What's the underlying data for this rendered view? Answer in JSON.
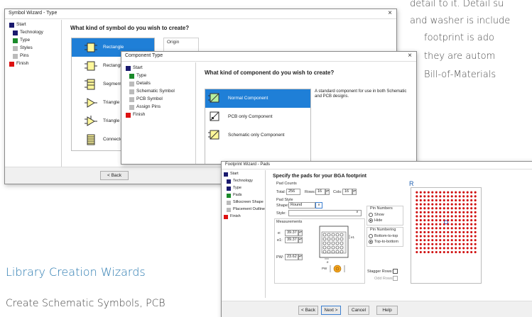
{
  "background": {
    "line1": "detail to it. Detail su",
    "line2": "and washer is include",
    "line3": "footprint is ado",
    "line4": "they are autom",
    "line5": "Bill-of-Materials",
    "heading": "Library Creation Wizards",
    "subtext": "Create Schematic Symbols, PCB"
  },
  "symbol_wizard": {
    "title": "Symbol Wizard - Type",
    "close": "×",
    "steps": [
      {
        "label": "Start",
        "color": "#1a1a6e"
      },
      {
        "label": "Technology",
        "color": "#1a1a6e"
      },
      {
        "label": "Type",
        "color": "#1a8a2a"
      },
      {
        "label": "Styles",
        "color": "#bbbbbb"
      },
      {
        "label": "Pins",
        "color": "#bbbbbb"
      },
      {
        "label": "Finish",
        "color": "#dd1111"
      }
    ],
    "question": "What kind of symbol do you wish to create?",
    "origin_label": "Origin",
    "items": [
      "Rectangle",
      "Rectangle",
      "Segmented Recta",
      "Triangle",
      "Triangle",
      "Connector"
    ],
    "back": "< Back"
  },
  "component_type": {
    "title": "Component Type",
    "close": "×",
    "steps": [
      {
        "label": "Start",
        "color": "#1a1a6e"
      },
      {
        "label": "Type",
        "color": "#1a8a2a"
      },
      {
        "label": "Details",
        "color": "#bbbbbb"
      },
      {
        "label": "Schematic Symbol",
        "color": "#bbbbbb"
      },
      {
        "label": "PCB Symbol",
        "color": "#bbbbbb"
      },
      {
        "label": "Assign Pins",
        "color": "#bbbbbb"
      },
      {
        "label": "Finish",
        "color": "#dd1111"
      }
    ],
    "question": "What kind of component do you wish to create?",
    "items": [
      "Normal Component",
      "PCB only Component",
      "Schematic only Component"
    ],
    "description": "A standard component for use in both Schematic and PCB designs."
  },
  "footprint_wizard": {
    "title": "Footprint Wizard - Pads",
    "close": "×",
    "steps": [
      {
        "label": "Start",
        "color": "#1a1a6e"
      },
      {
        "label": "Technology",
        "color": "#1a1a6e"
      },
      {
        "label": "Type",
        "color": "#1a1a6e"
      },
      {
        "label": "Pads",
        "color": "#1a8a2a"
      },
      {
        "label": "Silkscreen Shape",
        "color": "#bbbbbb"
      },
      {
        "label": "Placement Outline",
        "color": "#bbbbbb"
      },
      {
        "label": "Finish",
        "color": "#dd1111"
      }
    ],
    "question": "Specify the pads for your BGA footprint",
    "pad_counts_label": "Pad Counts",
    "total_label": "Total:",
    "total_value": "256",
    "rows_label": "Rows:",
    "rows_value": "16",
    "cols_label": "Cols:",
    "cols_value": "16",
    "pad_style_label": "Pad Style",
    "shape_label": "Shape:",
    "shape_value": "Round",
    "style_label": "Style:",
    "style_value": "",
    "measurements_label": "Measurements",
    "e_label": "e:",
    "e_value": "39.37",
    "e1_label": "e1:",
    "e1_value": "39.37",
    "pw_label": "PW:",
    "pw_value": "23.62",
    "dim_e1": "e1",
    "dim_e": "e",
    "dim_pw": "PW",
    "pin_numbers_label": "Pin Numbers",
    "show_label": "Show",
    "hide_label": "Hide",
    "pin_numbering_label": "Pin Numbering",
    "bottom_to_top": "Bottom-to-top",
    "top_to_bottom": "Top-to-bottom",
    "stagger_rows_label": "Stagger Rows:",
    "odd_rows_label": "Odd Rows:",
    "back": "< Back",
    "next": "Next >",
    "cancel": "Cancel",
    "help": "Help",
    "preview_label": "R",
    "grid_rows": 16,
    "grid_cols": 16
  }
}
